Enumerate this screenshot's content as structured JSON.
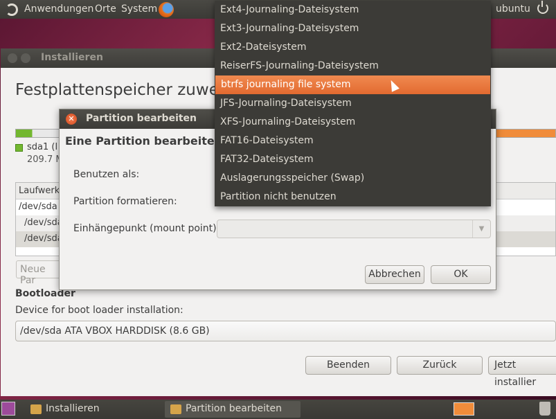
{
  "top_panel": {
    "menus": [
      "Anwendungen",
      "Orte",
      "System"
    ],
    "user": "ubuntu",
    "icons": [
      "ubuntu-logo-icon",
      "firefox-icon",
      "power-icon"
    ]
  },
  "installer": {
    "title": "Installieren",
    "heading": "Festplattenspeicher zuwe",
    "partition_label": "sda1 (l",
    "partition_size": "209.7 M",
    "table": {
      "header": "Laufwerk",
      "rows": [
        "/dev/sda",
        "/dev/sda",
        "/dev/sda"
      ]
    },
    "new_partition_button": "Neue Par",
    "bootloader_heading": "Bootloader",
    "bootloader_label": "Device for boot loader installation:",
    "bootloader_value": "/dev/sda ATA VBOX HARDDISK (8.6 GB)",
    "buttons": {
      "quit": "Beenden",
      "back": "Zurück",
      "install": "Jetzt installier"
    }
  },
  "dialog": {
    "title": "Partition bearbeiten",
    "heading": "Eine Partition bearbeite",
    "use_as_label": "Benutzen als:",
    "format_label": "Partition formatieren:",
    "mount_label": "Einhängepunkt (mount point):",
    "mount_value": "",
    "cancel": "Abbrechen",
    "ok": "OK"
  },
  "menu": {
    "items": [
      "Ext4-Journaling-Dateisystem",
      "Ext3-Journaling-Dateisystem",
      "Ext2-Dateisystem",
      "ReiserFS-Journaling-Dateisystem",
      "btrfs journaling file system",
      "JFS-Journaling-Dateisystem",
      "XFS-Journaling-Dateisystem",
      "FAT16-Dateisystem",
      "FAT32-Dateisystem",
      "Auslagerungsspeicher (Swap)",
      "Partition nicht benutzen"
    ],
    "highlighted": "btrfs journaling file system"
  },
  "bottom_panel": {
    "tasks": [
      "Installieren",
      "Partition bearbeiten"
    ],
    "active_task": "Partition bearbeiten"
  },
  "colors": {
    "accent": "#e26a30",
    "panel": "#3c3b37",
    "window_bg": "#f2f1f0"
  }
}
